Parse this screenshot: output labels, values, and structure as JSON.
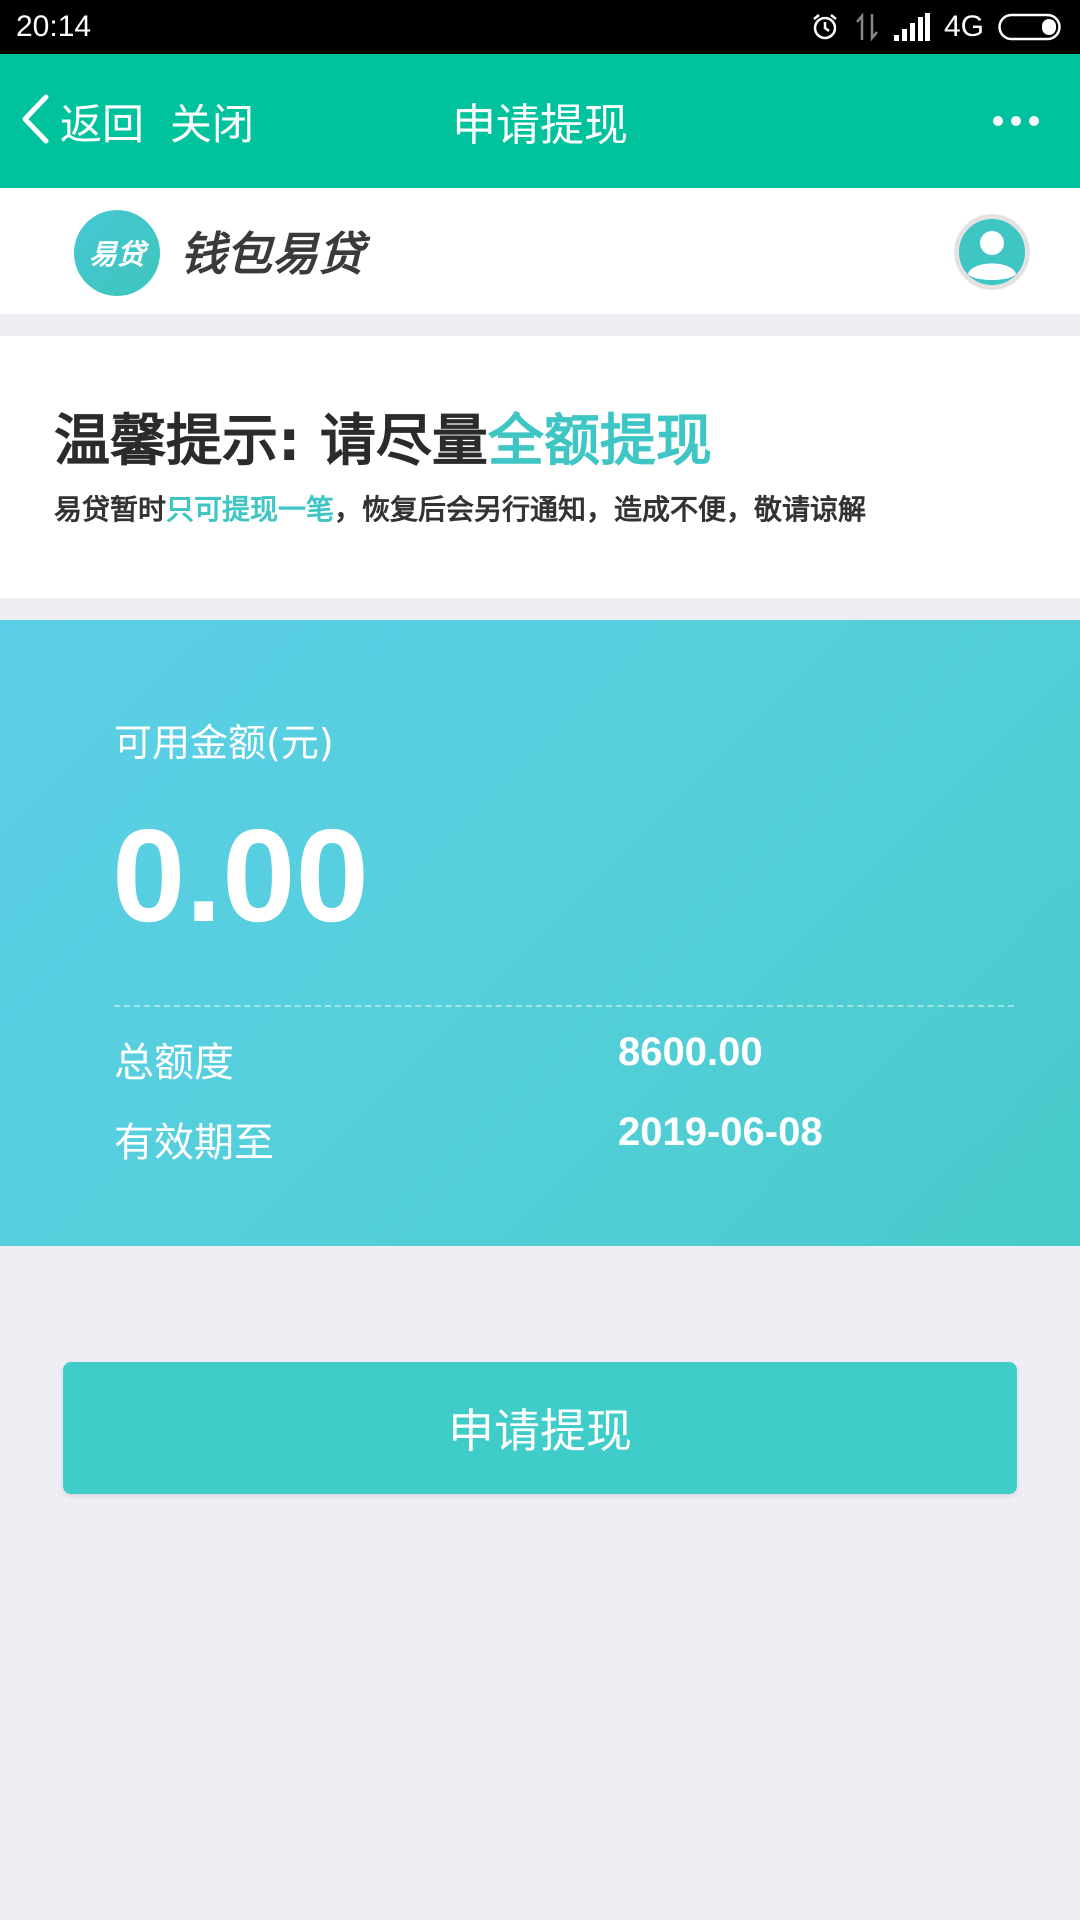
{
  "status_bar": {
    "time": "20:14",
    "network": "4G",
    "icons": [
      "alarm-icon",
      "data-transfer-icon",
      "signal-icon",
      "battery-icon"
    ]
  },
  "nav": {
    "back_label": "返回",
    "close_label": "关闭",
    "title": "申请提现",
    "icons": [
      "chevron-left-icon",
      "more-icon"
    ],
    "bar_color": "#00c29d"
  },
  "brand": {
    "logo_text": "易贷",
    "name": "钱包易贷",
    "icons": [
      "avatar-icon"
    ]
  },
  "notice": {
    "title_prefix": "温馨提示: 请尽量",
    "title_highlight": "全额提现",
    "sub_prefix": "易贷暂时",
    "sub_highlight": "只可提现一笔",
    "sub_suffix": "，恢复后会另行通知，造成不便，敬请谅解",
    "accent_color": "#3fc6c4"
  },
  "balance": {
    "label": "可用金额(元)",
    "amount": "0.00",
    "rows": [
      {
        "label": "总额度",
        "value": "8600.00"
      },
      {
        "label": "有效期至",
        "value": "2019-06-08"
      }
    ]
  },
  "action": {
    "apply_label": "申请提现",
    "button_color": "#40ccc8"
  }
}
